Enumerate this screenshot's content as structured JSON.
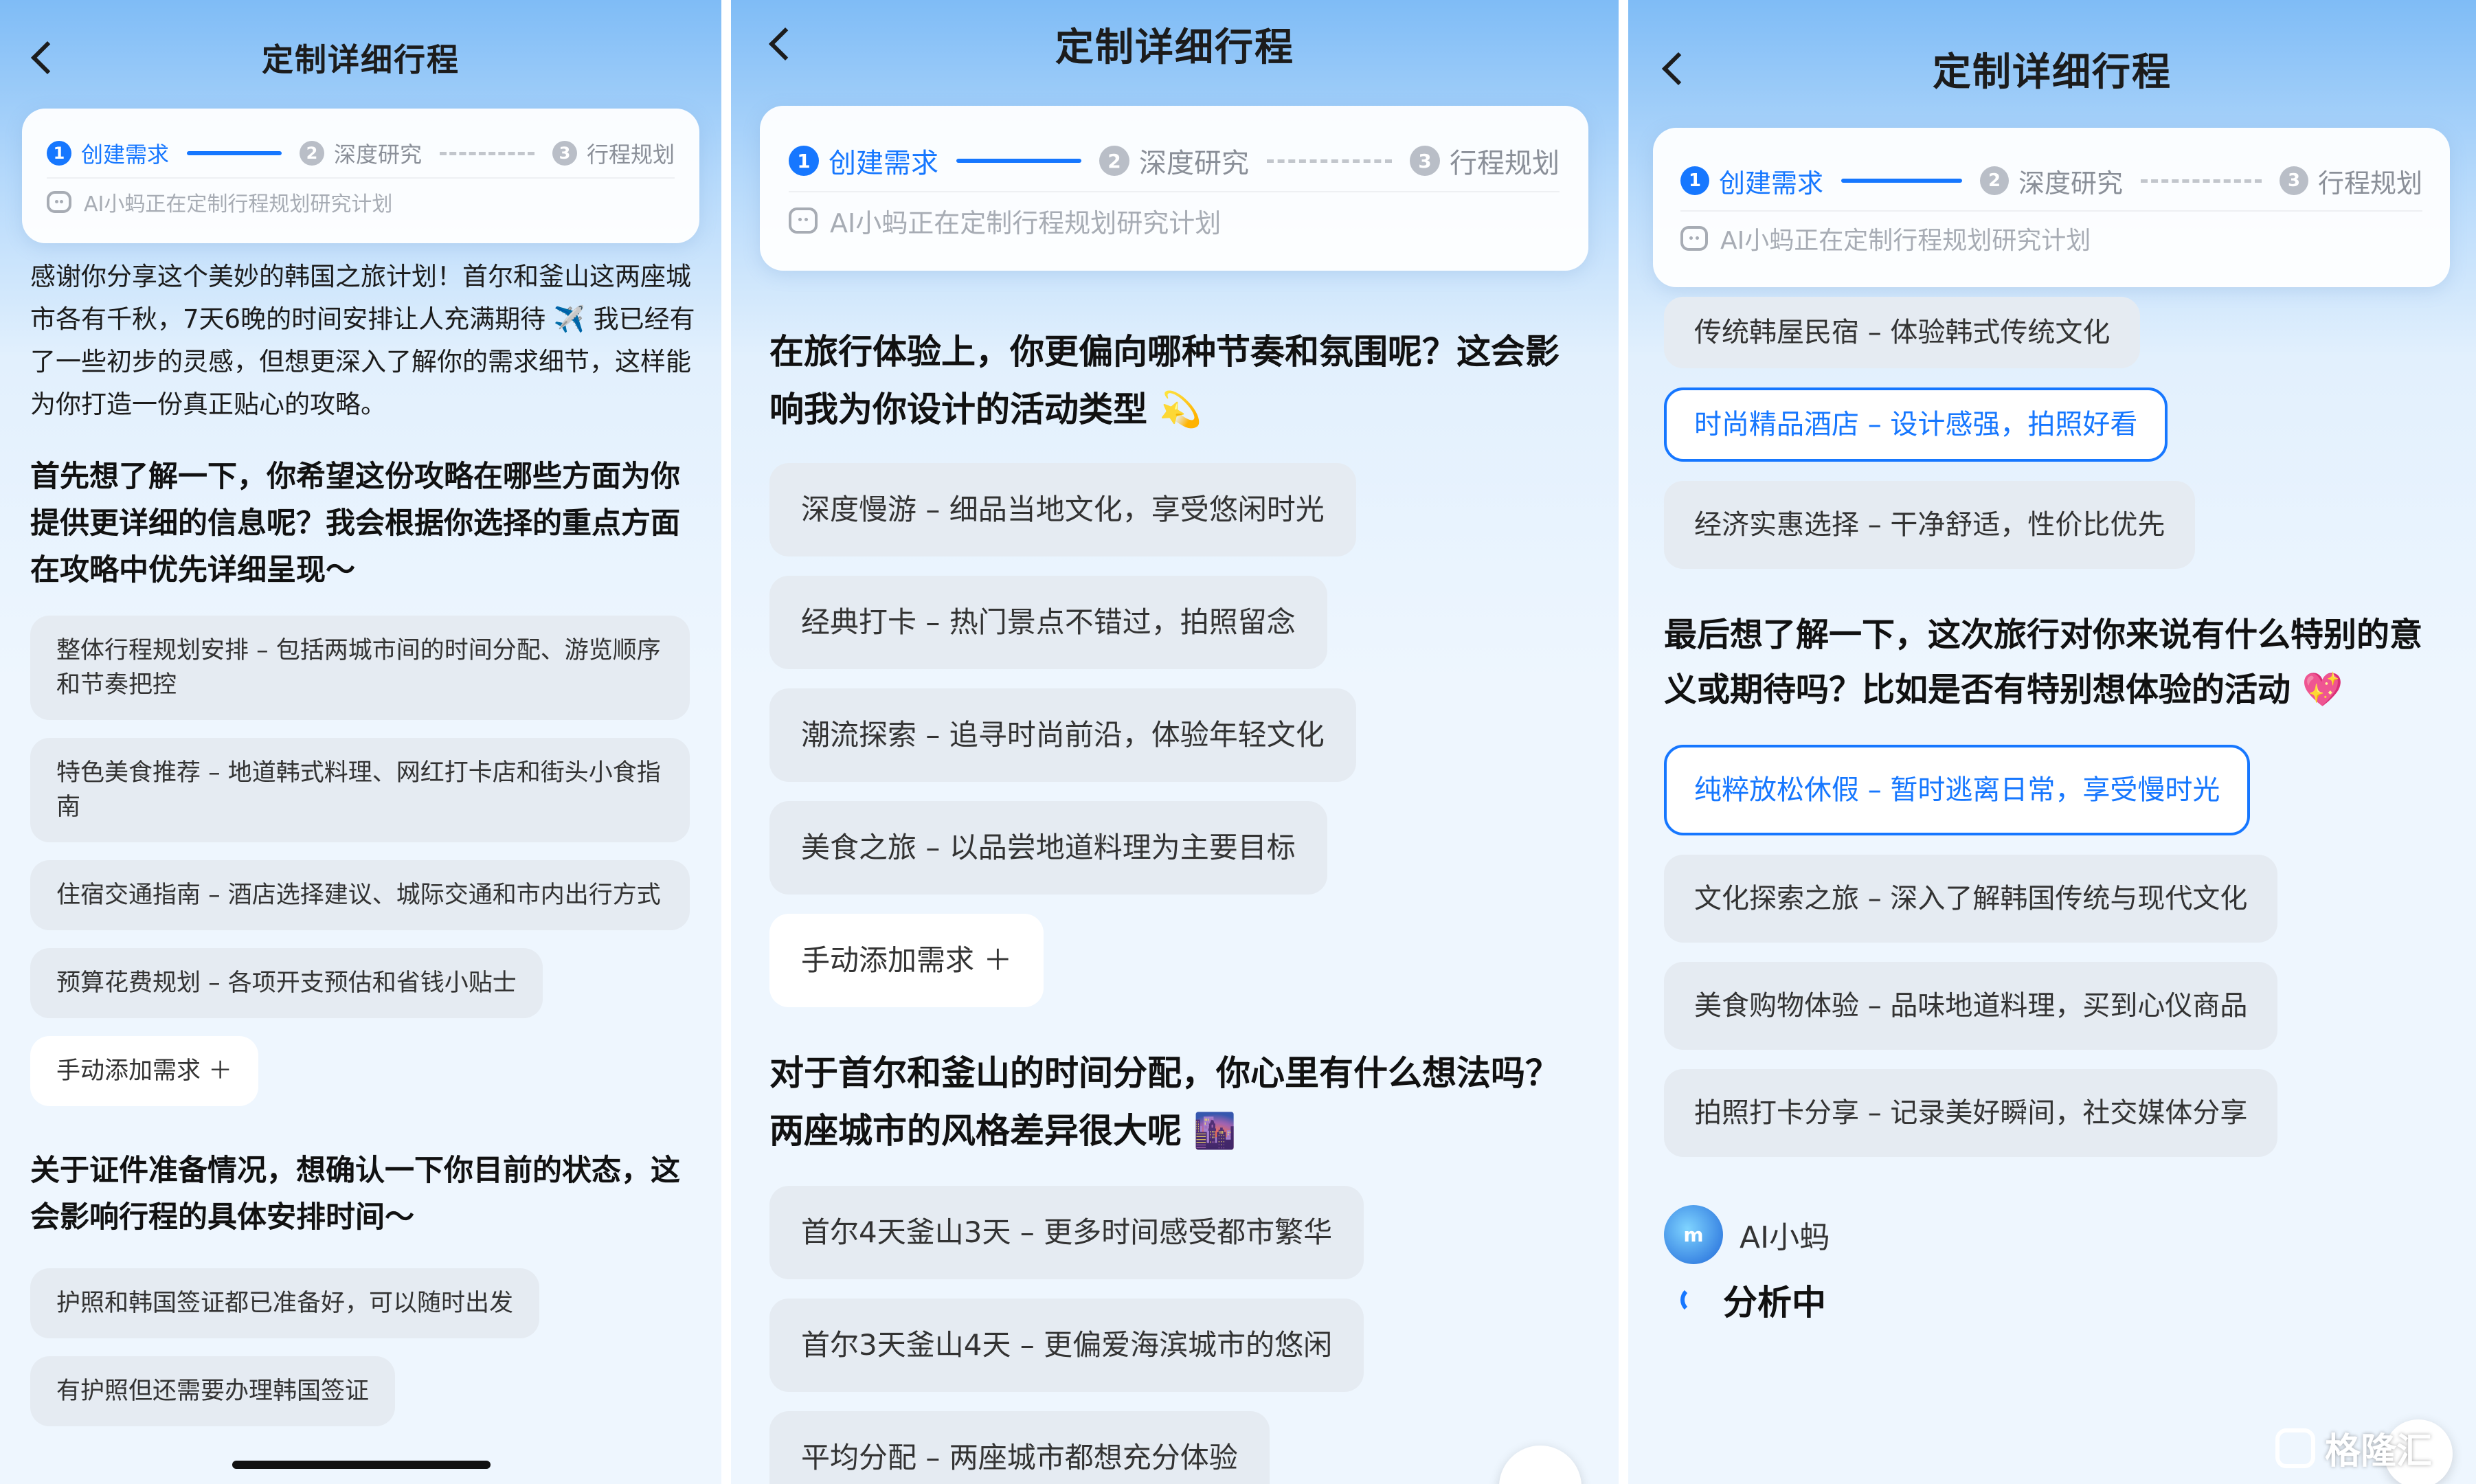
{
  "nav": {
    "title": "定制详细行程"
  },
  "steps": [
    {
      "num": "1",
      "label": "创建需求"
    },
    {
      "num": "2",
      "label": "深度研究"
    },
    {
      "num": "3",
      "label": "行程规划"
    }
  ],
  "status": "AI小蚂正在定制行程规划研究计划",
  "screen1": {
    "intro": "感谢你分享这个美妙的韩国之旅计划！首尔和釜山这两座城市各有千秋，7天6晚的时间安排让人充满期待 ✈️ 我已经有了一些初步的灵感，但想更深入了解你的需求细节，这样能为你打造一份真正贴心的攻略。",
    "question1": "首先想了解一下，你希望这份攻略在哪些方面为你提供更详细的信息呢？我会根据你选择的重点方面在攻略中优先详细呈现～",
    "options1": [
      "整体行程规划安排 – 包括两城市间的时间分配、游览顺序和节奏把控",
      "特色美食推荐 – 地道韩式料理、网红打卡店和街头小食指南",
      "住宿交通指南 – 酒店选择建议、城际交通和市内出行方式",
      "预算花费规划 – 各项开支预估和省钱小贴士"
    ],
    "add_label": "手动添加需求 ＋",
    "question2": "关于证件准备情况，想确认一下你目前的状态，这会影响行程的具体安排时间～",
    "options2": [
      "护照和韩国签证都已准备好，可以随时出发",
      "有护照但还需要办理韩国签证"
    ]
  },
  "screen2": {
    "question1": "在旅行体验上，你更偏向哪种节奏和氛围呢？这会影响我为你设计的活动类型 💫",
    "options1": [
      "深度慢游 – 细品当地文化，享受悠闲时光",
      "经典打卡 – 热门景点不错过，拍照留念",
      "潮流探索 – 追寻时尚前沿，体验年轻文化",
      "美食之旅 – 以品尝地道料理为主要目标"
    ],
    "add_label": "手动添加需求 ＋",
    "question2": "对于首尔和釜山的时间分配，你心里有什么想法吗？两座城市的风格差异很大呢 🌆",
    "options2": [
      "首尔4天釜山3天 – 更多时间感受都市繁华",
      "首尔3天釜山4天 – 更偏爱海滨城市的悠闲",
      "平均分配 – 两座城市都想充分体验"
    ]
  },
  "screen3": {
    "options_top": [
      "传统韩屋民宿 – 体验韩式传统文化",
      "时尚精品酒店 – 设计感强，拍照好看",
      "经济实惠选择 – 干净舒适，性价比优先"
    ],
    "question": "最后想了解一下，这次旅行对你来说有什么特别的意义或期待吗？比如是否有特别想体验的活动 💖",
    "options": [
      "纯粹放松休假 – 暂时逃离日常，享受慢时光",
      "文化探索之旅 – 深入了解韩国传统与现代文化",
      "美食购物体验 – 品味地道料理，买到心仪商品",
      "拍照打卡分享 – 记录美好瞬间，社交媒体分享"
    ],
    "assistant_name": "AI小蚂",
    "analyzing": "分析中"
  },
  "watermark": "格隆汇",
  "colors": {
    "accent": "#1677ff",
    "option_bg": "#e5ebf2",
    "text": "#1c1c1c"
  }
}
